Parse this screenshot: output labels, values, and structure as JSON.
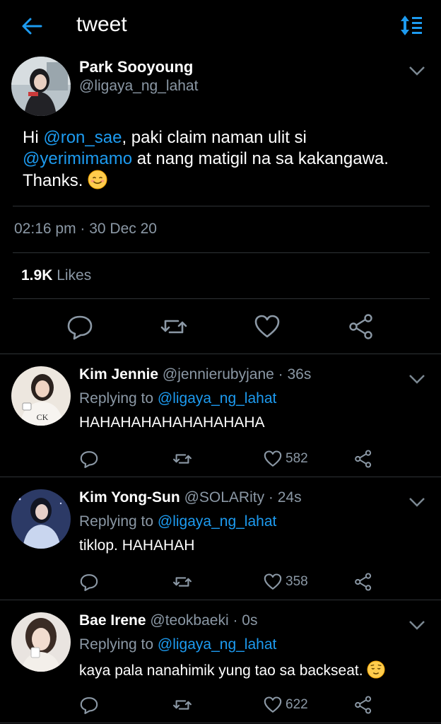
{
  "header": {
    "title": "tweet"
  },
  "tweet": {
    "name": "Park Sooyoung",
    "handle": "@ligaya_ng_lahat",
    "text_prefix": "Hi ",
    "mention1": "@ron_sae",
    "text_mid": ", paki claim naman ulit si",
    "mention2": "@yerimimamo",
    "text_after": " at nang matigil na sa kakangawa.",
    "text_end": "Thanks. ",
    "emoji": "smiling-face-emoji",
    "time": "02:16 pm · 30 Dec 20",
    "likes_count": "1.9K",
    "likes_label": "Likes"
  },
  "replies": [
    {
      "name": "Kim Jennie",
      "handle": "@jennierubyjane · 36s",
      "replying_prefix": "Replying to ",
      "replying_to": "@ligaya_ng_lahat",
      "text": "HAHAHAHAHAHAHAHAHA",
      "likes": "582"
    },
    {
      "name": "Kim Yong-Sun",
      "handle": "@SOLARity · 24s",
      "replying_prefix": "Replying to ",
      "replying_to": "@ligaya_ng_lahat",
      "text": "tiklop. HAHAHAH",
      "likes": "358"
    },
    {
      "name": "Bae Irene",
      "handle": "@teokbaeki · 0s",
      "replying_prefix": "Replying to ",
      "replying_to": "@ligaya_ng_lahat",
      "text": "kaya pala nanahimik yung tao sa backseat. ",
      "emoji": "relieved-face-emoji",
      "likes": "622"
    }
  ],
  "colors": {
    "accent": "#1d9bf0",
    "background": "#000000",
    "muted": "#8b98a5"
  }
}
